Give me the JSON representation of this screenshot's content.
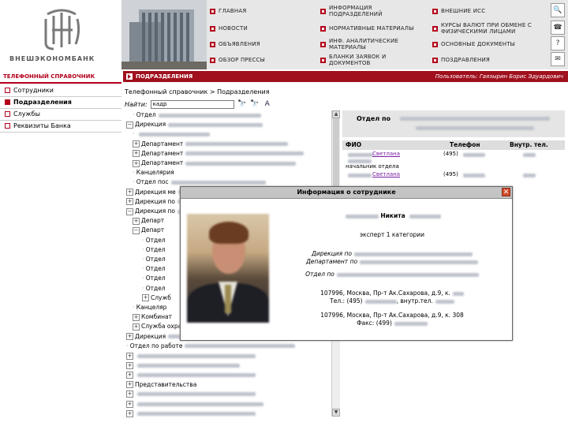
{
  "brand": {
    "name": "ВНЕШЭКОНОМБАНК"
  },
  "top_menu": {
    "items": [
      {
        "label": "ГЛАВНАЯ"
      },
      {
        "label": "ИНФОРМАЦИЯ\nПОДРАЗДЕЛЕНИЙ"
      },
      {
        "label": "ВНЕШНИЕ ИСС"
      },
      {
        "label": "НОВОСТИ"
      },
      {
        "label": "НОРМАТИВНЫЕ МАТЕРИАЛЫ"
      },
      {
        "label": "КУРСЫ ВАЛЮТ ПРИ ОБМЕНЕ С\nФИЗИЧЕСКИМИ ЛИЦАМИ"
      },
      {
        "label": "ОБЪЯВЛЕНИЯ"
      },
      {
        "label": "ИНФ. АНАЛИТИЧЕСКИЕ\nМАТЕРИАЛЫ"
      },
      {
        "label": "ОСНОВНЫЕ ДОКУМЕНТЫ"
      },
      {
        "label": "ОБЗОР ПРЕССЫ"
      },
      {
        "label": "БЛАНКИ ЗАЯВОК И\nДОКУМЕНТОВ"
      },
      {
        "label": "ПОЗДРАВЛЕНИЯ"
      }
    ],
    "icons": [
      "search-icon",
      "phone-icon",
      "help-icon",
      "mail-icon"
    ]
  },
  "topbar": {
    "phone_tab": "ТЕЛЕФОННЫЙ СПРАВОЧНИК",
    "sections_tab": "ПОДРАЗДЕЛЕНИЯ",
    "user": "Пользователь: Гаязырин Борис Эдуардович"
  },
  "left_nav": {
    "items": [
      {
        "label": "Сотрудники"
      },
      {
        "label": "Подразделения"
      },
      {
        "label": "Службы"
      },
      {
        "label": "Реквизиты Банка"
      }
    ]
  },
  "breadcrumb": "Телефонный справочник > Подразделения",
  "search": {
    "label": "Найти:",
    "value": "кадр"
  },
  "tree": {
    "rows": [
      {
        "label": "Отдел",
        "toggle": "",
        "indent": 1
      },
      {
        "label": "Дирекция",
        "toggle": "−",
        "indent": 0
      },
      {
        "label": "",
        "toggle": "",
        "indent": 1
      },
      {
        "label": "Департамент",
        "toggle": "+",
        "indent": 1
      },
      {
        "label": "Департамент",
        "toggle": "+",
        "indent": 1
      },
      {
        "label": "Департамент",
        "toggle": "+",
        "indent": 1
      },
      {
        "label": "Канцелярия",
        "toggle": "",
        "indent": 1
      },
      {
        "label": "Отдел пос",
        "toggle": "",
        "indent": 1
      },
      {
        "label": "Дирекция ме",
        "toggle": "+",
        "indent": 0
      },
      {
        "label": "Дирекция по",
        "toggle": "+",
        "indent": 0
      },
      {
        "label": "Дирекция по",
        "toggle": "−",
        "indent": 0
      },
      {
        "label": "Департ",
        "toggle": "+",
        "indent": 1
      },
      {
        "label": "Департ",
        "toggle": "−",
        "indent": 1
      },
      {
        "label": "Отдел",
        "toggle": "",
        "indent": 2
      },
      {
        "label": "Отдел",
        "toggle": "",
        "indent": 2
      },
      {
        "label": "Отдел",
        "toggle": "",
        "indent": 2
      },
      {
        "label": "Отдел",
        "toggle": "",
        "indent": 2
      },
      {
        "label": "Отдел",
        "toggle": "",
        "indent": 2
      },
      {
        "label": "Отдел",
        "toggle": "",
        "indent": 2
      },
      {
        "label": "Служб",
        "toggle": "+",
        "indent": 2
      },
      {
        "label": "Канцеляр",
        "toggle": "",
        "indent": 1
      },
      {
        "label": "Комбинат",
        "toggle": "+",
        "indent": 1
      },
      {
        "label": "Служба охраны труда",
        "toggle": "+",
        "indent": 1
      },
      {
        "label": "Дирекция",
        "toggle": "+",
        "indent": 0
      },
      {
        "label": "Отдел по работе",
        "toggle": "",
        "indent": 0
      },
      {
        "label": "",
        "toggle": "+",
        "indent": 0
      },
      {
        "label": "",
        "toggle": "+",
        "indent": 0
      },
      {
        "label": "",
        "toggle": "+",
        "indent": 0
      },
      {
        "label": "Представительства",
        "toggle": "+",
        "indent": 0
      },
      {
        "label": "",
        "toggle": "+",
        "indent": 0
      },
      {
        "label": "",
        "toggle": "+",
        "indent": 0
      },
      {
        "label": "",
        "toggle": "+",
        "indent": 0
      }
    ]
  },
  "dept_panel": {
    "title": "Отдел по"
  },
  "emp_table": {
    "headers": [
      "ФИО",
      "Телефон",
      "Внутр. тел."
    ],
    "rows": [
      {
        "name": "Светлана",
        "position": "начальник отдела",
        "phone": "(495)"
      },
      {
        "name": "Светлана",
        "position": "",
        "phone": "(495)"
      }
    ]
  },
  "modal": {
    "title": "Информация о сотруднике",
    "name": "Никита",
    "position": "эксперт 1 категории",
    "directorate": "Дирекция по",
    "department": "Департамент по",
    "division": "Отдел по",
    "address1": "107996, Москва, Пр-т Ак.Сахарова, д.9, к.",
    "phone": "Тел.: (495)",
    "ext": ", внутр.тел.",
    "address2": "107996, Москва, Пр-т Ак.Сахарова, д.9, к. 308",
    "fax": "Факс: (499)"
  }
}
